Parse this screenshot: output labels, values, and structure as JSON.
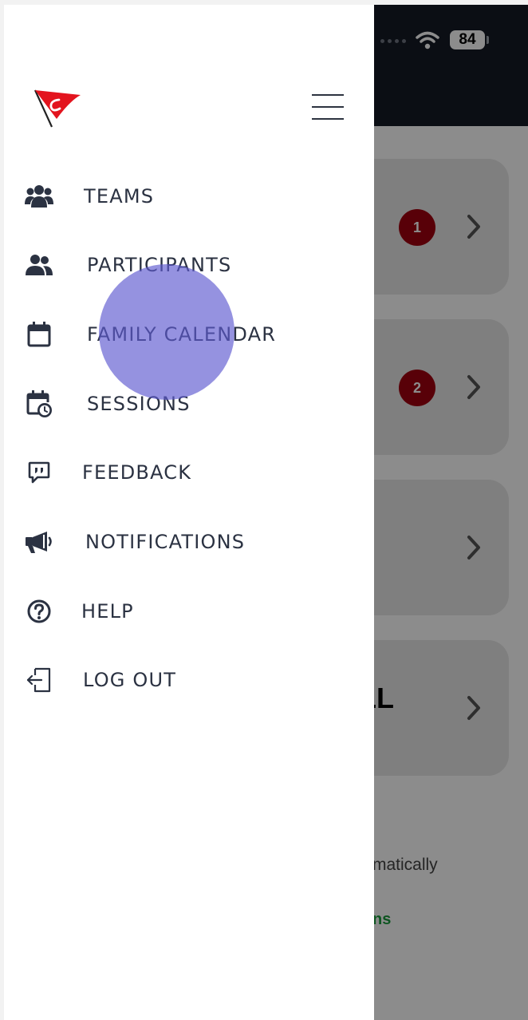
{
  "status_bar": {
    "battery": "84"
  },
  "background": {
    "badges": [
      "1",
      "2"
    ],
    "text_big": "LL",
    "text_small": "matically",
    "text_green": "ns"
  },
  "menu": {
    "items": [
      {
        "label": "TEAMS",
        "icon": "users-group-icon"
      },
      {
        "label": "PARTICIPANTS",
        "icon": "users-icon"
      },
      {
        "label": "FAMILY CALENDAR",
        "icon": "calendar-icon"
      },
      {
        "label": "SESSIONS",
        "icon": "calendar-clock-icon"
      },
      {
        "label": "FEEDBACK",
        "icon": "quote-bubble-icon"
      },
      {
        "label": "NOTIFICATIONS",
        "icon": "megaphone-icon"
      },
      {
        "label": "HELP",
        "icon": "question-circle-icon"
      },
      {
        "label": "LOG OUT",
        "icon": "logout-icon"
      }
    ]
  },
  "colors": {
    "header_dark": "#141a26",
    "badge_red": "#a1000f",
    "menu_text": "#2b3242",
    "logo_red": "#e3141e",
    "touch_indicator": "#5e5ad0",
    "green_text": "#1a9b3c"
  }
}
